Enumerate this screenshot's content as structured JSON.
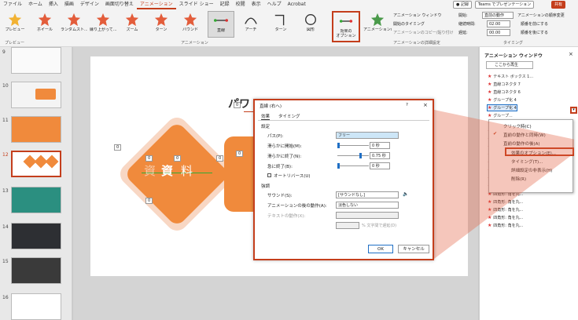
{
  "menubar": {
    "items": [
      "ファイル",
      "ホーム",
      "挿入",
      "描画",
      "デザイン",
      "画面切り替え",
      "アニメーション",
      "スライド ショー",
      "記録",
      "校閲",
      "表示",
      "ヘルプ",
      "Acrobat"
    ],
    "active_index": 6,
    "record": "記録",
    "teams": "Teams でプレゼンテーション",
    "share": "共有"
  },
  "ribbon": {
    "preview": "プレビュー",
    "effects": [
      "ホイール",
      "ランダムスト...",
      "縁り上がって...",
      "ズーム",
      "ターン",
      "バウンド",
      "直線",
      "アーチ",
      "ターン",
      "図形"
    ],
    "options": "効果の\nオプション",
    "add_anim": "アニメーションの追加",
    "anim_window": "アニメーション ウィンドウ",
    "trigger": "開始のタイミング",
    "painter": "アニメーションのコピー/貼り付け",
    "start_label": "開始:",
    "start_value": "直前の動作",
    "duration_label": "継続時間:",
    "duration_value": "02.00",
    "delay_label": "遅延:",
    "delay_value": "00.00",
    "reorder": "アニメーションの順序変更",
    "earlier": "順番を前にする",
    "later": "順番を後にする",
    "group_preview": "プレビュー",
    "group_animation": "アニメーション",
    "group_advanced": "アニメーションの詳細設定",
    "group_timing": "タイミング"
  },
  "slides": {
    "numbers": [
      "9",
      "10",
      "11",
      "12",
      "13",
      "14",
      "15",
      "16"
    ],
    "selected": "12"
  },
  "slide": {
    "title": "パワ",
    "text1": "資",
    "text2": "料",
    "tags": [
      "0",
      "0",
      "0",
      "0",
      "0",
      "0",
      "0"
    ]
  },
  "animpane": {
    "title": "アニメーション ウィンドウ",
    "play": "ここから再生",
    "items": [
      "テキスト ボックス 1...",
      "直線コネクタ 7",
      "直線コネクタ 6",
      "グループ化 4",
      "グループ化 4",
      "グループ...",
      "グループ...",
      "グループ...",
      "四角形: 角を丸...",
      "四角形: 角を丸...",
      "四角形: 角を丸...",
      "四角形: 角を丸...",
      "四角形: 角を丸...",
      "四角形: 角を丸...",
      "四角形: 角を丸...",
      "四角形: 角を丸...",
      "四角形: 角を丸...",
      "四角形: 角を丸...",
      "四角形: 角を丸...",
      "四角形: 角を丸..."
    ]
  },
  "context_menu": {
    "items": [
      "クリック時(C)",
      "直前の動作と同時(W)",
      "直前の動作の後(A)",
      "効果のオプション(E)...",
      "タイミング(T)...",
      "詳細設定の非表示(H)",
      "削除(R)"
    ]
  },
  "dialog": {
    "title": "直線 (右へ)",
    "help": "?",
    "close": "×",
    "tabs": [
      "効果",
      "タイミング"
    ],
    "section1": "設定",
    "path_label": "パス(P):",
    "path_value": "フリー",
    "smooth_start_label": "滑らかに開始(M):",
    "smooth_start_value": "0 秒",
    "smooth_end_label": "滑らかに終了(N):",
    "smooth_end_value": "0.75 秒",
    "bounce_label": "急に終了(B):",
    "bounce_value": "0 秒",
    "autoreverse": "オートリバース(U)",
    "section2": "強調",
    "sound_label": "サウンド(S):",
    "sound_value": "[サウンドなし]",
    "after_label": "アニメーションの後の動作(A):",
    "after_value": "淡色しない",
    "text_label": "テキストの動作(X):",
    "text_value": "",
    "text_delay": "% 文字間で遅延(D)",
    "ok": "OK",
    "cancel": "キャンセル"
  },
  "colors": {
    "accent": "#c43e1c",
    "orange": "#f08a3c",
    "highlight": "#c43e1c"
  }
}
